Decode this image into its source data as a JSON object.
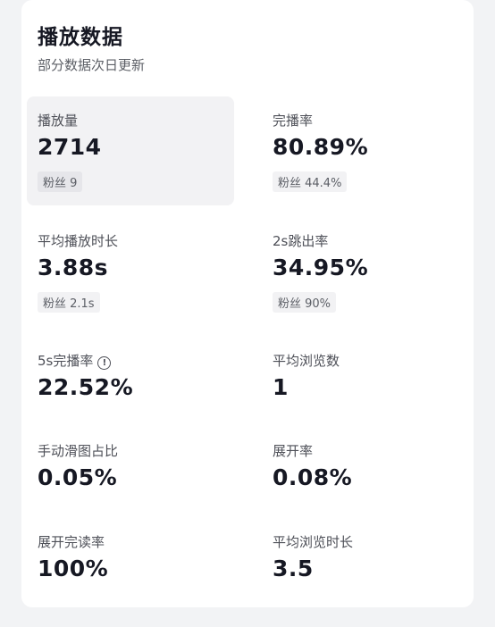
{
  "header": {
    "title": "播放数据",
    "subtitle": "部分数据次日更新"
  },
  "metrics": [
    {
      "label": "播放量",
      "value": "2714",
      "tag": "粉丝 9"
    },
    {
      "label": "完播率",
      "value": "80.89%",
      "tag": "粉丝 44.4%"
    },
    {
      "label": "平均播放时长",
      "value": "3.88s",
      "tag": "粉丝 2.1s"
    },
    {
      "label": "2s跳出率",
      "value": "34.95%",
      "tag": "粉丝 90%"
    },
    {
      "label": "5s完播率",
      "value": "22.52%",
      "icon": "info-icon",
      "icon_glyph": "!"
    },
    {
      "label": "平均浏览数",
      "value": "1"
    },
    {
      "label": "手动滑图占比",
      "value": "0.05%"
    },
    {
      "label": "展开率",
      "value": "0.08%"
    },
    {
      "label": "展开完读率",
      "value": "100%"
    },
    {
      "label": "平均浏览时长",
      "value": "3.5"
    }
  ]
}
